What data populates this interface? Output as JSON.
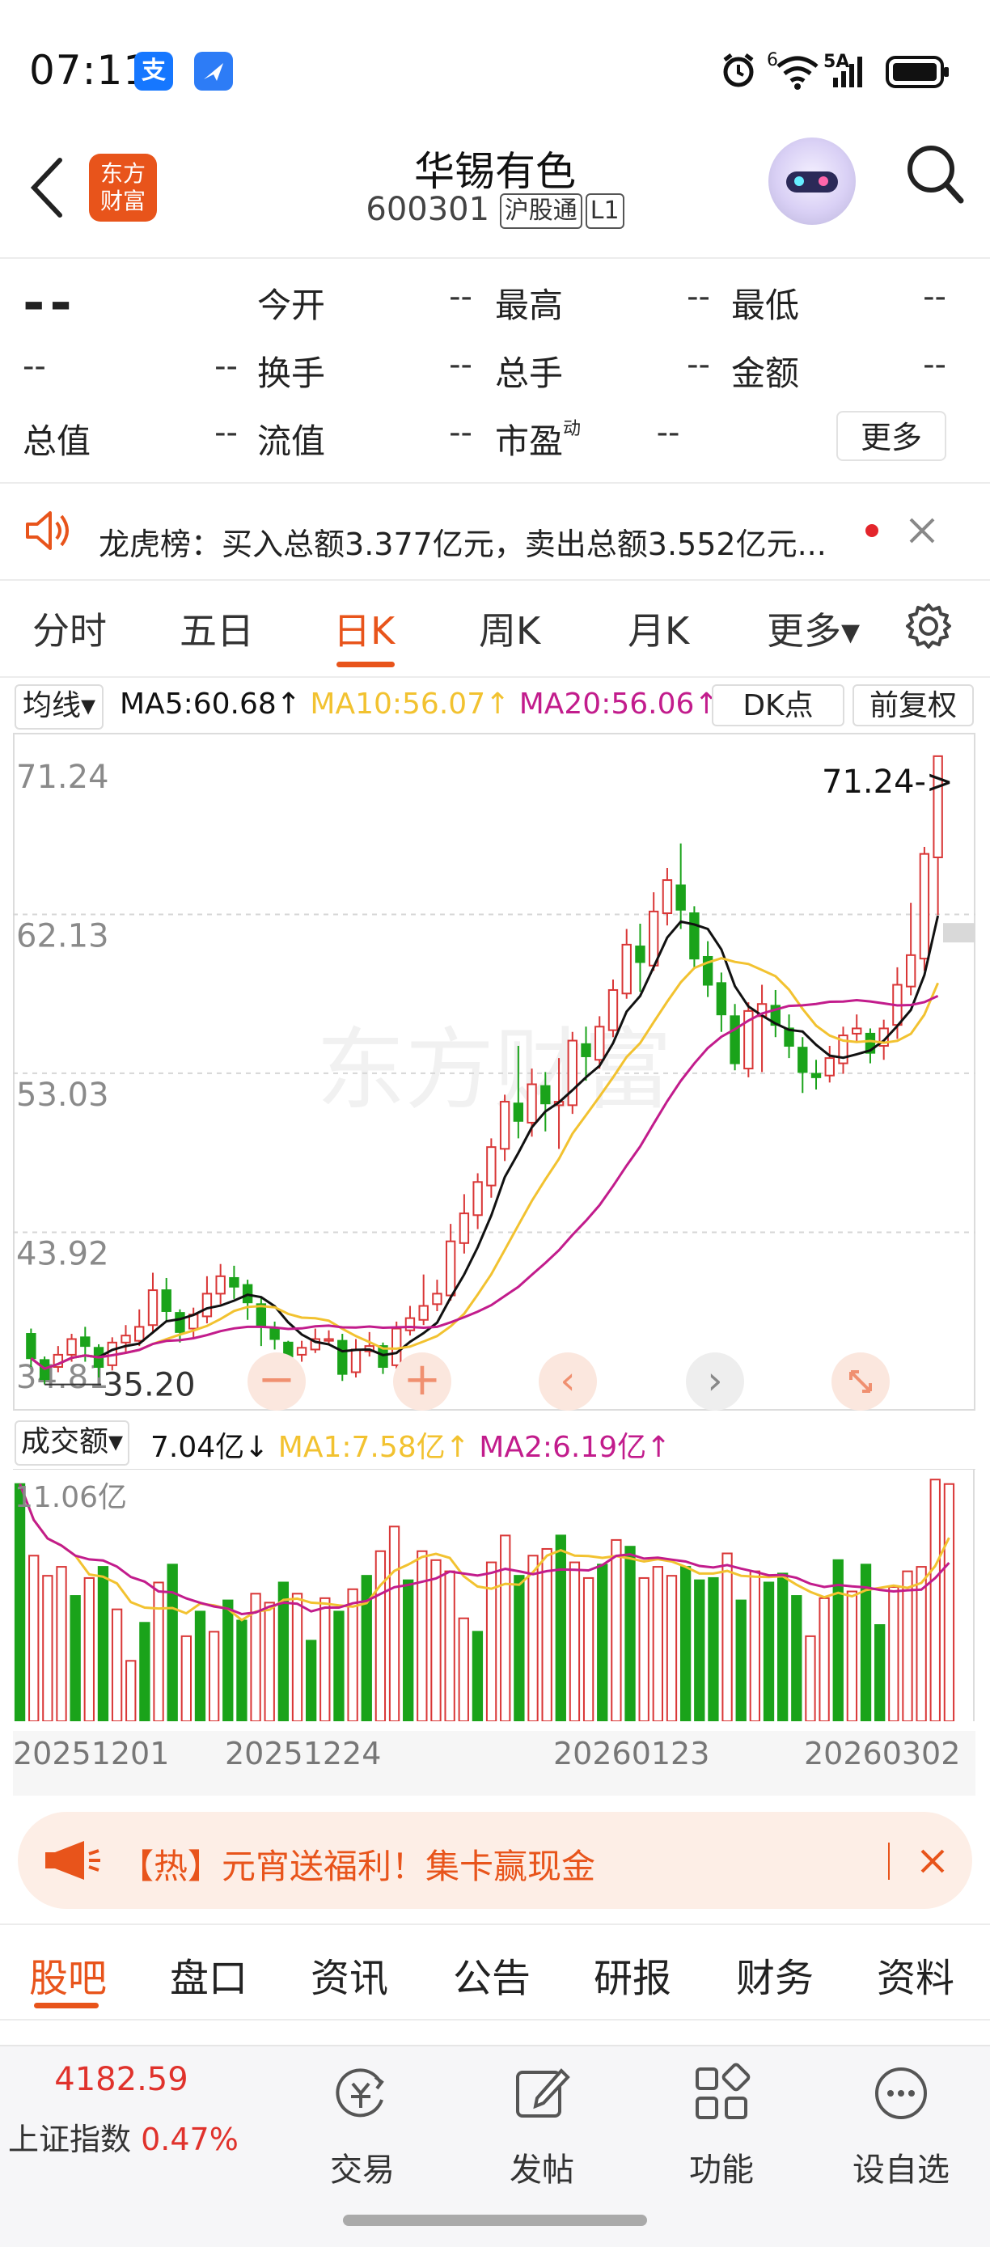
{
  "status_bar": {
    "time": "07:11",
    "alipay_icon": "alipay-icon",
    "app_icon": "plane-app-icon",
    "net": "6",
    "net2": "5A"
  },
  "header": {
    "title": "华锡有色",
    "code": "600301",
    "tag1": "沪股通",
    "tag2": "L1",
    "logo_line1": "东方",
    "logo_line2": "财富"
  },
  "quote": {
    "price": "--",
    "row1": [
      {
        "label": "今开",
        "value": "--"
      },
      {
        "label": "最高",
        "value": "--"
      },
      {
        "label": "最低",
        "value": "--"
      }
    ],
    "row2_left_a": "--",
    "row2_left_b": "--",
    "row2": [
      {
        "label": "换手",
        "value": "--"
      },
      {
        "label": "总手",
        "value": "--"
      },
      {
        "label": "金额",
        "value": "--"
      }
    ],
    "row3": [
      {
        "label": "总值",
        "value": "--"
      },
      {
        "label": "流值",
        "value": "--"
      },
      {
        "label": "市盈",
        "value": "--"
      }
    ],
    "pe_sup": "动",
    "more": "更多"
  },
  "notice": {
    "label": "龙虎榜：",
    "text": "买入总额3.377亿元，卖出总额3.552亿元..."
  },
  "ktabs": {
    "items": [
      "分时",
      "五日",
      "日K",
      "周K",
      "月K",
      "更多▾"
    ],
    "active": 2
  },
  "ma_bar": {
    "selector": "均线▾",
    "ma5": "MA5:60.68↑",
    "ma10": "MA10:56.07↑",
    "ma20": "MA20:56.06↑",
    "dk": "DK点",
    "adj": "前复权"
  },
  "chart_data": {
    "type": "candlestick",
    "ylim": [
      34.81,
      71.24
    ],
    "yticks": [
      "71.24",
      "62.13",
      "53.03",
      "43.92",
      "34.81"
    ],
    "ma_lines": [
      {
        "name": "MA5",
        "color": "#111111"
      },
      {
        "name": "MA10",
        "color": "#f2c230"
      },
      {
        "name": "MA20",
        "color": "#c21c8c"
      }
    ],
    "candles": [
      [
        38.1,
        36.7,
        38.4,
        36.2
      ],
      [
        36.6,
        35.5,
        36.8,
        35.2
      ],
      [
        36.2,
        36.9,
        37.4,
        35.9
      ],
      [
        36.9,
        37.8,
        38.1,
        36.5
      ],
      [
        37.9,
        37.4,
        38.5,
        36.5
      ],
      [
        37.3,
        36.2,
        37.5,
        35.6
      ],
      [
        36.3,
        37.6,
        37.9,
        36.0
      ],
      [
        37.6,
        38.0,
        38.6,
        37.0
      ],
      [
        37.7,
        38.5,
        39.5,
        37.4
      ],
      [
        38.6,
        40.6,
        41.6,
        38.2
      ],
      [
        40.6,
        39.4,
        41.3,
        38.8
      ],
      [
        39.3,
        38.2,
        39.5,
        37.6
      ],
      [
        38.4,
        39.2,
        39.6,
        37.8
      ],
      [
        39.1,
        40.4,
        41.4,
        38.7
      ],
      [
        40.4,
        41.4,
        42.1,
        39.8
      ],
      [
        41.3,
        40.8,
        42.0,
        40.1
      ],
      [
        40.9,
        39.9,
        41.2,
        38.9
      ],
      [
        39.8,
        38.5,
        40.2,
        37.4
      ],
      [
        38.4,
        37.8,
        38.8,
        37.2
      ],
      [
        37.6,
        36.8,
        37.7,
        36.1
      ],
      [
        36.9,
        37.3,
        37.7,
        36.5
      ],
      [
        37.2,
        37.8,
        38.4,
        37.0
      ],
      [
        37.7,
        37.8,
        38.3,
        37.5
      ],
      [
        37.7,
        35.8,
        38.1,
        35.4
      ],
      [
        35.9,
        37.2,
        37.8,
        35.6
      ],
      [
        37.1,
        37.4,
        38.2,
        36.8
      ],
      [
        37.4,
        36.2,
        37.6,
        35.8
      ],
      [
        36.3,
        38.4,
        38.8,
        36.1
      ],
      [
        38.3,
        39.0,
        39.7,
        38.0
      ],
      [
        38.9,
        39.7,
        41.5,
        38.6
      ],
      [
        39.8,
        40.4,
        41.2,
        39.4
      ],
      [
        40.3,
        43.4,
        44.4,
        40.0
      ],
      [
        43.3,
        45.0,
        46.1,
        42.7
      ],
      [
        44.9,
        46.8,
        47.3,
        44.1
      ],
      [
        46.6,
        48.8,
        49.3,
        45.9
      ],
      [
        48.7,
        51.4,
        51.8,
        48.0
      ],
      [
        51.3,
        50.3,
        54.6,
        49.3
      ],
      [
        50.2,
        52.4,
        53.3,
        49.4
      ],
      [
        52.3,
        51.3,
        53.1,
        49.7
      ],
      [
        51.2,
        51.4,
        53.9,
        48.7
      ],
      [
        51.2,
        54.9,
        55.4,
        50.7
      ],
      [
        54.7,
        54.0,
        55.7,
        52.6
      ],
      [
        53.8,
        55.7,
        56.3,
        53.3
      ],
      [
        55.5,
        57.8,
        58.4,
        55.1
      ],
      [
        57.6,
        60.4,
        61.3,
        57.3
      ],
      [
        60.3,
        59.4,
        61.6,
        57.7
      ],
      [
        59.2,
        62.3,
        63.4,
        58.9
      ],
      [
        62.2,
        64.1,
        64.8,
        61.5
      ],
      [
        63.8,
        62.4,
        66.2,
        61.3
      ],
      [
        62.2,
        59.6,
        62.6,
        59.1
      ],
      [
        59.7,
        58.1,
        60.6,
        57.4
      ],
      [
        58.2,
        56.4,
        58.8,
        55.4
      ],
      [
        56.3,
        53.6,
        57.0,
        53.2
      ],
      [
        53.3,
        56.6,
        57.1,
        52.8
      ],
      [
        56.3,
        57.0,
        58.1,
        53.1
      ],
      [
        56.9,
        55.8,
        57.8,
        55.1
      ],
      [
        55.6,
        54.6,
        56.4,
        53.9
      ],
      [
        54.5,
        53.1,
        55.1,
        51.9
      ],
      [
        53.0,
        52.8,
        53.8,
        52.1
      ],
      [
        52.9,
        53.9,
        54.6,
        52.5
      ],
      [
        53.6,
        55.2,
        55.7,
        53.0
      ],
      [
        55.3,
        55.6,
        56.4,
        54.8
      ],
      [
        55.3,
        54.2,
        55.6,
        53.6
      ],
      [
        54.6,
        55.6,
        56.1,
        53.8
      ],
      [
        55.8,
        58.1,
        59.1,
        55.0
      ],
      [
        58.0,
        59.8,
        62.8,
        57.5
      ],
      [
        59.6,
        65.6,
        66.0,
        58.9
      ],
      [
        65.4,
        71.2,
        71.2,
        62.1
      ]
    ],
    "last_label": "71.24->",
    "low_label": "35.20",
    "watermark": "东方财富"
  },
  "vol_bar": {
    "selector": "成交额▾",
    "value": "7.04亿↓",
    "ma1": "MA1:7.58亿↑",
    "ma2": "MA2:6.19亿↑",
    "ymax": "11.06亿"
  },
  "volume_data": {
    "unit": "亿",
    "values": [
      10.6,
      7.4,
      6.5,
      6.9,
      5.6,
      6.4,
      6.9,
      5.0,
      2.7,
      4.4,
      6.2,
      7.0,
      3.8,
      4.9,
      4.0,
      5.4,
      4.5,
      5.7,
      5.3,
      6.2,
      5.7,
      3.6,
      5.5,
      4.9,
      5.9,
      6.5,
      7.6,
      8.7,
      6.3,
      7.6,
      7.2,
      6.7,
      4.6,
      4.0,
      7.1,
      8.3,
      6.5,
      7.4,
      7.7,
      8.3,
      7.1,
      6.4,
      7.0,
      8.1,
      7.8,
      6.4,
      6.9,
      6.5,
      6.9,
      6.3,
      6.4,
      7.5,
      5.4,
      6.7,
      6.2,
      6.6,
      5.6,
      3.8,
      5.5,
      7.2,
      5.8,
      7.0,
      4.3,
      6.0,
      6.7,
      6.9,
      10.8,
      10.6
    ],
    "up": [
      false,
      true,
      true,
      true,
      false,
      true,
      false,
      true,
      true,
      false,
      true,
      false,
      true,
      false,
      true,
      false,
      false,
      true,
      true,
      false,
      true,
      false,
      true,
      false,
      true,
      false,
      true,
      true,
      false,
      true,
      true,
      true,
      true,
      false,
      true,
      true,
      false,
      true,
      true,
      false,
      true,
      true,
      false,
      true,
      false,
      true,
      true,
      true,
      false,
      false,
      false,
      true,
      false,
      true,
      false,
      false,
      false,
      true,
      true,
      false,
      true,
      false,
      false,
      true,
      true,
      true,
      true,
      true
    ]
  },
  "date_axis": [
    "20251201",
    "20251224",
    "20260123",
    "20260302"
  ],
  "promo": {
    "text": "【热】元宵送福利！集卡赢现金"
  },
  "nav_tabs": [
    "股吧",
    "盘口",
    "资讯",
    "公告",
    "研报",
    "财务",
    "资料"
  ],
  "bottom_nav": {
    "index_value": "4182.59",
    "index_name": "上证指数",
    "index_change": "0.47%",
    "items": [
      "交易",
      "发帖",
      "功能",
      "设自选"
    ]
  },
  "colors": {
    "up": "#d93636",
    "down": "#1aa31a",
    "accent": "#e8541b",
    "ma5": "#111111",
    "ma10": "#f2c230",
    "ma20": "#c21c8c"
  }
}
